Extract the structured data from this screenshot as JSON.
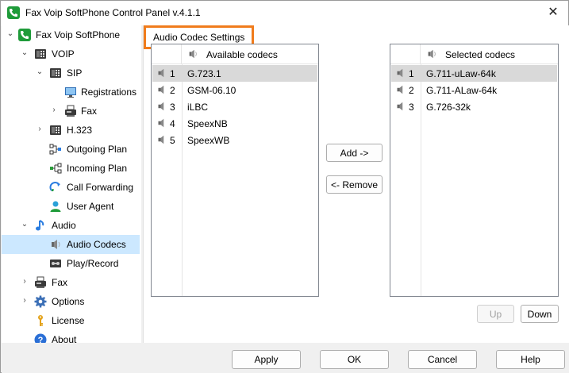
{
  "window": {
    "title": "Fax Voip SoftPhone Control Panel v.4.1.1",
    "close_glyph": "✕"
  },
  "tree": {
    "items": [
      {
        "label": "Fax Voip SoftPhone",
        "icon": "phone-app-icon"
      },
      {
        "label": "VOIP",
        "icon": "voip-phone-icon"
      },
      {
        "label": "SIP",
        "icon": "sip-phone-icon"
      },
      {
        "label": "Registrations",
        "icon": "monitor-icon"
      },
      {
        "label": "Fax",
        "icon": "fax-machine-icon"
      },
      {
        "label": "H.323",
        "icon": "h323-phone-icon"
      },
      {
        "label": "Outgoing Plan",
        "icon": "outgoing-plan-icon"
      },
      {
        "label": "Incoming Plan",
        "icon": "incoming-plan-icon"
      },
      {
        "label": "Call Forwarding",
        "icon": "call-forwarding-icon"
      },
      {
        "label": "User Agent",
        "icon": "user-icon"
      },
      {
        "label": "Audio",
        "icon": "music-note-icon"
      },
      {
        "label": "Audio Codecs",
        "icon": "speaker-icon"
      },
      {
        "label": "Play/Record",
        "icon": "tape-recorder-icon"
      },
      {
        "label": "Fax",
        "icon": "fax-machine-icon"
      },
      {
        "label": "Options",
        "icon": "gear-icon"
      },
      {
        "label": "License",
        "icon": "key-icon"
      },
      {
        "label": "About",
        "icon": "help-icon"
      }
    ],
    "selected": "Audio Codecs"
  },
  "main": {
    "section_title": "Audio Codec Settings",
    "available": {
      "header": "Available codecs",
      "rows": [
        {
          "num": "1",
          "name": "G.723.1"
        },
        {
          "num": "2",
          "name": "GSM-06.10"
        },
        {
          "num": "3",
          "name": "iLBC"
        },
        {
          "num": "4",
          "name": "SpeexNB"
        },
        {
          "num": "5",
          "name": "SpeexWB"
        }
      ]
    },
    "selected": {
      "header": "Selected codecs",
      "rows": [
        {
          "num": "1",
          "name": "G.711-uLaw-64k"
        },
        {
          "num": "2",
          "name": "G.711-ALaw-64k"
        },
        {
          "num": "3",
          "name": "G.726-32k"
        }
      ]
    },
    "add_label": "Add ->",
    "remove_label": "<- Remove",
    "up_label": "Up",
    "down_label": "Down"
  },
  "footer": {
    "apply_label": "Apply",
    "ok_label": "OK",
    "cancel_label": "Cancel",
    "help_label": "Help"
  },
  "colors": {
    "highlight_border": "#f07c1c",
    "tree_selection": "#cce8ff",
    "list_selection": "#d9d9d9",
    "brand_green": "#1f9b3a"
  }
}
